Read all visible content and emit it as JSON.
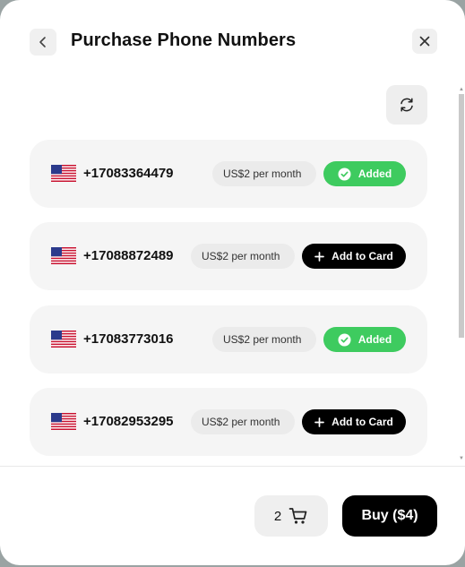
{
  "header": {
    "title": "Purchase Phone Numbers",
    "back_icon": "chevron-left-icon",
    "close_icon": "close-icon"
  },
  "refresh_icon": "refresh-icon",
  "numbers": [
    {
      "number": "+17083364479",
      "price": "US$2 per month",
      "status": "added",
      "action_label": "Added"
    },
    {
      "number": "+17088872489",
      "price": "US$2 per month",
      "status": "add",
      "action_label": "Add to Card"
    },
    {
      "number": "+17083773016",
      "price": "US$2 per month",
      "status": "added",
      "action_label": "Added"
    },
    {
      "number": "+17082953295",
      "price": "US$2 per month",
      "status": "add",
      "action_label": "Add to Card"
    }
  ],
  "footer": {
    "cart_count": "2",
    "cart_icon": "cart-icon",
    "buy_label": "Buy ($4)"
  },
  "colors": {
    "added": "#3ecb5f",
    "add": "#000000",
    "row_bg": "#f5f5f5",
    "price_bg": "#ebebeb"
  }
}
